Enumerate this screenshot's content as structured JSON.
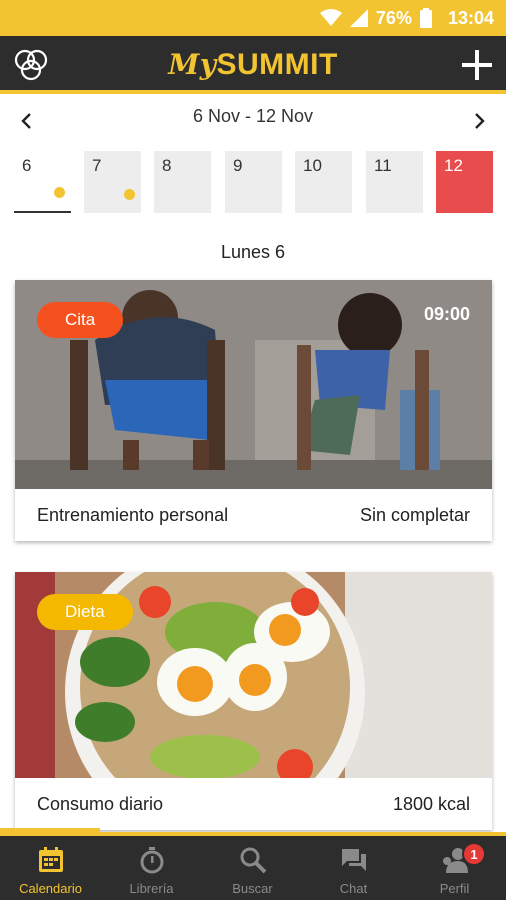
{
  "status_bar": {
    "battery": "76%",
    "time": "13:04"
  },
  "app": {
    "brand_prefix": "My",
    "brand_name": "SUMMIT"
  },
  "week": {
    "range": "6 Nov - 12 Nov"
  },
  "days": [
    {
      "num": "6",
      "has_event": true,
      "state": "selected"
    },
    {
      "num": "7",
      "has_event": true,
      "state": "normal"
    },
    {
      "num": "8",
      "has_event": false,
      "state": "normal"
    },
    {
      "num": "9",
      "has_event": false,
      "state": "normal"
    },
    {
      "num": "10",
      "has_event": false,
      "state": "normal"
    },
    {
      "num": "11",
      "has_event": false,
      "state": "normal"
    },
    {
      "num": "12",
      "has_event": false,
      "state": "today"
    }
  ],
  "day_title": "Lunes 6",
  "cards": [
    {
      "tag": "Cita",
      "tag_color": "#F4511E",
      "time": "09:00",
      "title": "Entrenamiento personal",
      "status": "Sin completar"
    },
    {
      "tag": "Dieta",
      "tag_color": "#F5B800",
      "title": "Consumo diario",
      "value": "1800 kcal"
    }
  ],
  "nav": {
    "items": [
      {
        "label": "Calendario",
        "icon": "calendar-icon",
        "active": true
      },
      {
        "label": "Librería",
        "icon": "stopwatch-icon",
        "active": false
      },
      {
        "label": "Buscar",
        "icon": "search-icon",
        "active": false
      },
      {
        "label": "Chat",
        "icon": "chat-icon",
        "active": false
      },
      {
        "label": "Perfil",
        "icon": "profile-icon",
        "active": false,
        "badge": "1"
      }
    ]
  },
  "colors": {
    "accent": "#F3C431",
    "dark": "#2D2D2D",
    "today": "#E84C4C"
  }
}
